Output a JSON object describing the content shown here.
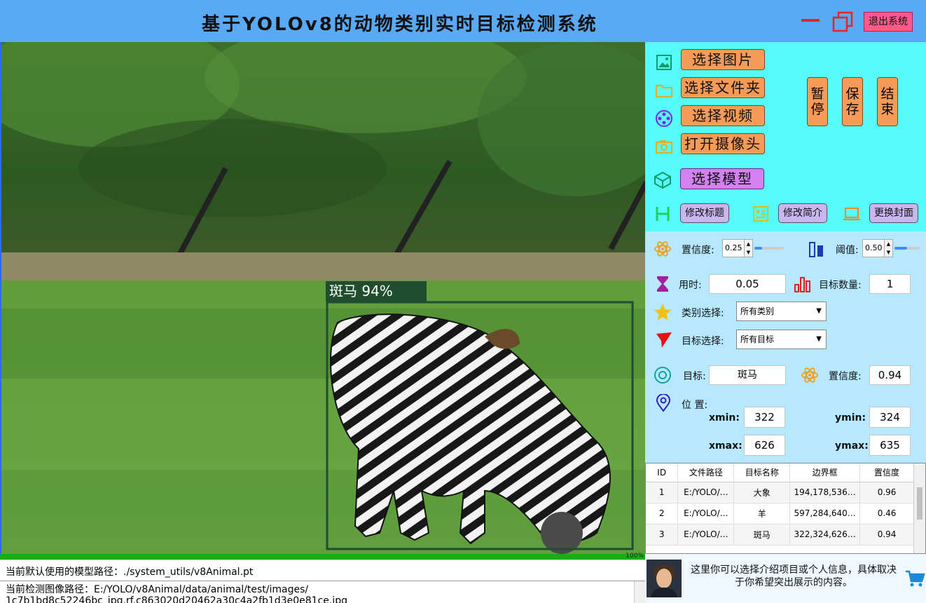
{
  "window": {
    "title": "基于YOLOv8的动物类别实时目标检测系统",
    "exit_label": "退出系统"
  },
  "viewer": {
    "detection_label": "斑马 94%",
    "progress": {
      "value": 1.0,
      "text": "100%"
    }
  },
  "status": {
    "model_path": "当前默认使用的模型路径：./system_utils/v8Animal.pt",
    "image_path_line1": "当前检测图像路径：E:/YOLO/v8Animal/data/animal/test/images/",
    "image_path_line2": "1c7b1bd8c52246bc_jpg.rf.c863020d20462a30c4a2fb1d3e0e81ce.jpg"
  },
  "controls": {
    "select_image": "选择图片",
    "select_folder": "选择文件夹",
    "select_video": "选择视频",
    "open_camera": "打开摄像头",
    "select_model": "选择模型",
    "pause": "暂停",
    "save": "保存",
    "stop": "结束",
    "edit_title": "修改标题",
    "edit_intro": "修改简介",
    "change_cover": "更换封面"
  },
  "params": {
    "confidence_label": "置信度:",
    "confidence_value": "0.25",
    "confidence_level": 0.25,
    "iou_label": "阈值:",
    "iou_value": "0.50",
    "iou_level": 0.5,
    "time_label": "用时:",
    "time_value": "0.05",
    "count_label": "目标数量:",
    "count_value": "1",
    "class_select_label": "类别选择:",
    "class_select_value": "所有类别",
    "target_select_label": "目标选择:",
    "target_select_value": "所有目标"
  },
  "result": {
    "target_label": "目标:",
    "target_value": "斑马",
    "conf_label": "置信度:",
    "conf_value": "0.94",
    "position_label": "位  置:",
    "xmin_label": "xmin:",
    "xmin": "322",
    "ymin_label": "ymin:",
    "ymin": "324",
    "xmax_label": "xmax:",
    "xmax": "626",
    "ymax_label": "ymax:",
    "ymax": "635"
  },
  "table": {
    "headers": [
      "ID",
      "文件路径",
      "目标名称",
      "边界框",
      "置信度"
    ],
    "rows": [
      [
        "1",
        "E:/YOLO/…",
        "大象",
        "194,178,536…",
        "0.96"
      ],
      [
        "2",
        "E:/YOLO/…",
        "羊",
        "597,284,640…",
        "0.46"
      ],
      [
        "3",
        "E:/YOLO/…",
        "斑马",
        "322,324,626…",
        "0.94"
      ]
    ]
  },
  "footer": {
    "intro_text": "这里你可以选择介绍项目或个人信息，具体取决于你希望突出展示的内容。"
  },
  "colors": {
    "titlebar": "#5aa9f4",
    "panel_top": "#55fbfb",
    "panel_mid": "#b6e9ff",
    "orange_button": "#f59a57",
    "purple_button": "#d380f0",
    "lavender_button": "#c7b6ef",
    "detection_box": "#1f4d2e",
    "progress": "#12b012"
  }
}
